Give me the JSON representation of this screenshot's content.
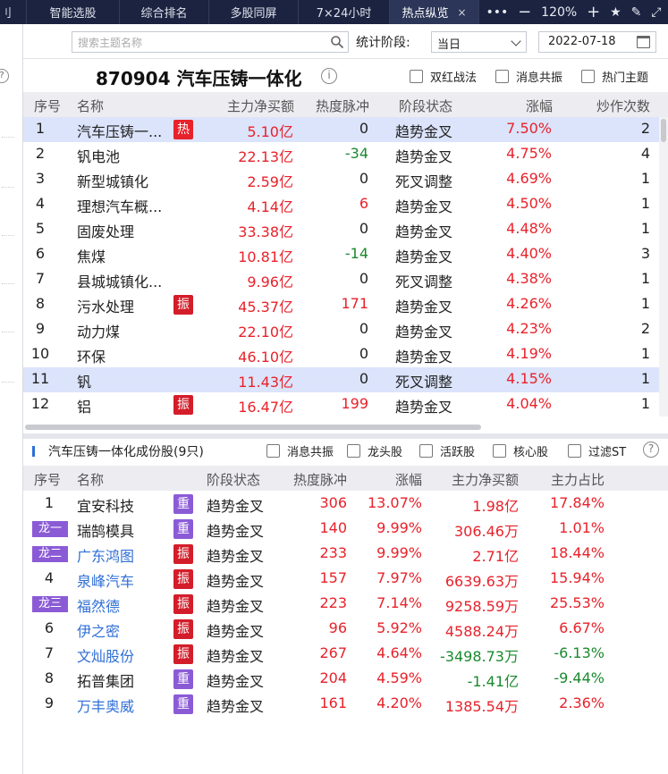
{
  "tabs": [
    {
      "label": "刂",
      "active": false
    },
    {
      "label": "智能选股",
      "active": false
    },
    {
      "label": "综合排名",
      "active": false
    },
    {
      "label": "多股同屏",
      "active": false
    },
    {
      "label": "7×24小时",
      "active": false
    },
    {
      "label": "热点纵览",
      "active": true,
      "close": "×"
    }
  ],
  "toolbar": {
    "more": "•••",
    "minus": "−",
    "zoom": "120%",
    "plus": "+",
    "star": "★",
    "edit": "✎",
    "expand": "⤢"
  },
  "filters": {
    "search_placeholder": "搜索主题名称",
    "stat_label": "统计阶段:",
    "stage_value": "当日",
    "date_value": "2022-07-18"
  },
  "theme": {
    "title": "870904 汽车压铸一体化",
    "info": "i",
    "options": [
      "双红战法",
      "消息共振",
      "热门主题"
    ]
  },
  "theme_table": {
    "headers": [
      "序号",
      "名称",
      "主力净买额",
      "热度脉冲",
      "阶段状态",
      "涨幅",
      "炒作次数"
    ],
    "rows": [
      {
        "no": "1",
        "name": "汽车压铸一...",
        "badge": "热",
        "net": "5.10亿",
        "pulse": "0",
        "stage": "趋势金叉",
        "change": "7.50%",
        "times": "2",
        "selected": true
      },
      {
        "no": "2",
        "name": "钒电池",
        "badge": "",
        "net": "22.13亿",
        "pulse": "-34",
        "stage": "趋势金叉",
        "change": "4.75%",
        "times": "4",
        "selected": false
      },
      {
        "no": "3",
        "name": "新型城镇化",
        "badge": "",
        "net": "2.59亿",
        "pulse": "0",
        "stage": "死叉调整",
        "change": "4.69%",
        "times": "1",
        "selected": false
      },
      {
        "no": "4",
        "name": "理想汽车概...",
        "badge": "",
        "net": "4.14亿",
        "pulse": "6",
        "stage": "趋势金叉",
        "change": "4.50%",
        "times": "1",
        "selected": false
      },
      {
        "no": "5",
        "name": "固废处理",
        "badge": "",
        "net": "33.38亿",
        "pulse": "0",
        "stage": "趋势金叉",
        "change": "4.48%",
        "times": "1",
        "selected": false
      },
      {
        "no": "6",
        "name": "焦煤",
        "badge": "",
        "net": "10.81亿",
        "pulse": "-14",
        "stage": "趋势金叉",
        "change": "4.40%",
        "times": "3",
        "selected": false
      },
      {
        "no": "7",
        "name": "县城城镇化...",
        "badge": "",
        "net": "9.96亿",
        "pulse": "0",
        "stage": "死叉调整",
        "change": "4.38%",
        "times": "1",
        "selected": false
      },
      {
        "no": "8",
        "name": "污水处理",
        "badge": "振",
        "net": "45.37亿",
        "pulse": "171",
        "stage": "趋势金叉",
        "change": "4.26%",
        "times": "1",
        "selected": false
      },
      {
        "no": "9",
        "name": "动力煤",
        "badge": "",
        "net": "22.10亿",
        "pulse": "0",
        "stage": "趋势金叉",
        "change": "4.23%",
        "times": "2",
        "selected": false
      },
      {
        "no": "10",
        "name": "环保",
        "badge": "",
        "net": "46.10亿",
        "pulse": "0",
        "stage": "趋势金叉",
        "change": "4.19%",
        "times": "1",
        "selected": false
      },
      {
        "no": "11",
        "name": "钒",
        "badge": "",
        "net": "11.43亿",
        "pulse": "0",
        "stage": "死叉调整",
        "change": "4.15%",
        "times": "1",
        "selected": true
      },
      {
        "no": "12",
        "name": "铝",
        "badge": "振",
        "net": "16.47亿",
        "pulse": "199",
        "stage": "趋势金叉",
        "change": "4.04%",
        "times": "1",
        "selected": false
      }
    ]
  },
  "stocks": {
    "title": "汽车压铸一体化成份股(9只)",
    "options": [
      "消息共振",
      "龙头股",
      "活跃股",
      "核心股",
      "过滤ST"
    ],
    "help": "?",
    "headers": [
      "序号",
      "名称",
      "阶段状态",
      "热度脉冲",
      "涨幅",
      "主力净买额",
      "主力占比"
    ],
    "rows": [
      {
        "no": "1",
        "dragon": "",
        "name": "宜安科技",
        "link": false,
        "badge": "重",
        "stage": "趋势金叉",
        "pulse": "306",
        "change": "13.07%",
        "net": "1.98亿",
        "ratio": "17.84%"
      },
      {
        "no": "",
        "dragon": "龙一",
        "name": "瑞鹄模具",
        "link": false,
        "badge": "重",
        "stage": "趋势金叉",
        "pulse": "140",
        "change": "9.99%",
        "net": "306.46万",
        "ratio": "1.01%"
      },
      {
        "no": "",
        "dragon": "龙二",
        "name": "广东鸿图",
        "link": true,
        "badge": "振",
        "stage": "趋势金叉",
        "pulse": "233",
        "change": "9.99%",
        "net": "2.71亿",
        "ratio": "18.44%"
      },
      {
        "no": "4",
        "dragon": "",
        "name": "泉峰汽车",
        "link": true,
        "badge": "振",
        "stage": "趋势金叉",
        "pulse": "157",
        "change": "7.97%",
        "net": "6639.63万",
        "ratio": "15.94%"
      },
      {
        "no": "",
        "dragon": "龙三",
        "name": "福然德",
        "link": true,
        "badge": "振",
        "stage": "趋势金叉",
        "pulse": "223",
        "change": "7.14%",
        "net": "9258.59万",
        "ratio": "25.53%"
      },
      {
        "no": "6",
        "dragon": "",
        "name": "伊之密",
        "link": true,
        "badge": "振",
        "stage": "趋势金叉",
        "pulse": "96",
        "change": "5.92%",
        "net": "4588.24万",
        "ratio": "6.67%"
      },
      {
        "no": "7",
        "dragon": "",
        "name": "文灿股份",
        "link": true,
        "badge": "振",
        "stage": "趋势金叉",
        "pulse": "267",
        "change": "4.64%",
        "net": "-3498.73万",
        "ratio": "-6.13%"
      },
      {
        "no": "8",
        "dragon": "",
        "name": "拓普集团",
        "link": false,
        "badge": "重",
        "stage": "趋势金叉",
        "pulse": "204",
        "change": "4.59%",
        "net": "-1.41亿",
        "ratio": "-9.44%"
      },
      {
        "no": "9",
        "dragon": "",
        "name": "万丰奥威",
        "link": true,
        "badge": "重",
        "stage": "趋势金叉",
        "pulse": "161",
        "change": "4.20%",
        "net": "1385.54万",
        "ratio": "2.36%"
      }
    ]
  },
  "colors": {
    "up": "#e8222b",
    "down": "#1a8a2e",
    "link": "#2f6fd6",
    "badge_purple": "#8b5bd6",
    "badge_red": "#d41d2a",
    "tab_bg": "#1b2340"
  }
}
